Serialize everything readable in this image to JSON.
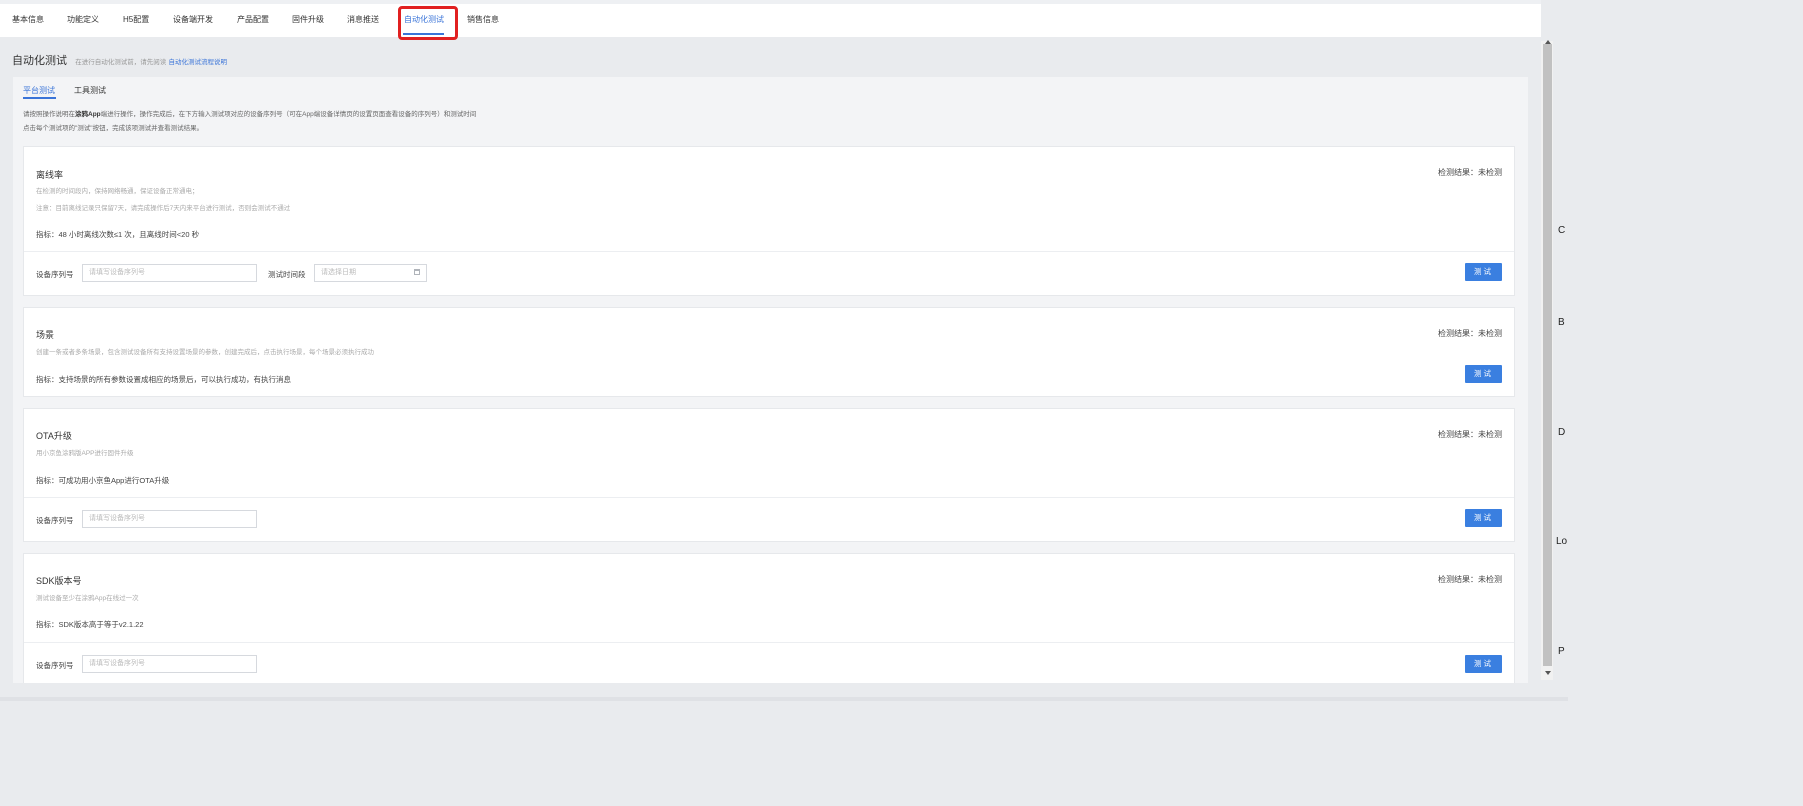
{
  "top_tabs": [
    "基本信息",
    "功能定义",
    "H5配置",
    "设备端开发",
    "产品配置",
    "固件升级",
    "消息推送",
    "自动化测试",
    "销售信息"
  ],
  "page": {
    "title": "自动化测试",
    "note": "在进行自动化测试前，请先阅读",
    "link": "自动化测试流程说明"
  },
  "sub_tabs": [
    "平台测试",
    "工具测试"
  ],
  "instructions": {
    "line1_pre": "请按照操作说明在",
    "line1_app": "涂鸦App",
    "line1_post": "端进行操作，操作完成后，在下方输入测试项对应的设备序列号（可在App端设备详情页的设置页面查看设备的序列号）和测试时间",
    "line2": "点击每个测试项的\"测试\"按钮，完成该项测试并查看测试结果。"
  },
  "cards": [
    {
      "title": "离线率",
      "result": "检测结果：未检测",
      "desc1": "在检测的时间段内，保持网络畅通，保证设备正常通电；",
      "desc2": "注意：目前离线记录只保留7天，请完成操作后7天内来平台进行测试，否则会测试不通过",
      "metric": "指标：48 小时离线次数≤1 次，且离线时间<20 秒",
      "serial_label": "设备序列号",
      "serial_placeholder": "请填写设备序列号",
      "time_label": "测试时间段",
      "time_placeholder": "请选择日期",
      "button": "测试"
    },
    {
      "title": "场景",
      "result": "检测结果：未检测",
      "desc1": "创建一条或者多条场景，包含测试设备所有支持设置场景的参数，创建完成后，点击执行场景，每个场景必须执行成功",
      "metric": "指标：支持场景的所有参数设置成相应的场景后，可以执行成功，有执行消息",
      "button": "测试"
    },
    {
      "title": "OTA升级",
      "result": "检测结果：未检测",
      "desc1": "用小京鱼涂鸦版APP进行固件升级",
      "metric": "指标：可成功用小京鱼App进行OTA升级",
      "serial_label": "设备序列号",
      "serial_placeholder": "请填写设备序列号",
      "button": "测试"
    },
    {
      "title": "SDK版本号",
      "result": "检测结果：未检测",
      "desc1": "测试设备至少在涂鸦App在线过一次",
      "metric": "指标：SDK版本高于等于v2.1.22",
      "serial_label": "设备序列号",
      "serial_placeholder": "请填写设备序列号",
      "button": "测试"
    }
  ],
  "right_edge_fragments": [
    "C",
    "B",
    "D",
    "Lo",
    "P"
  ]
}
